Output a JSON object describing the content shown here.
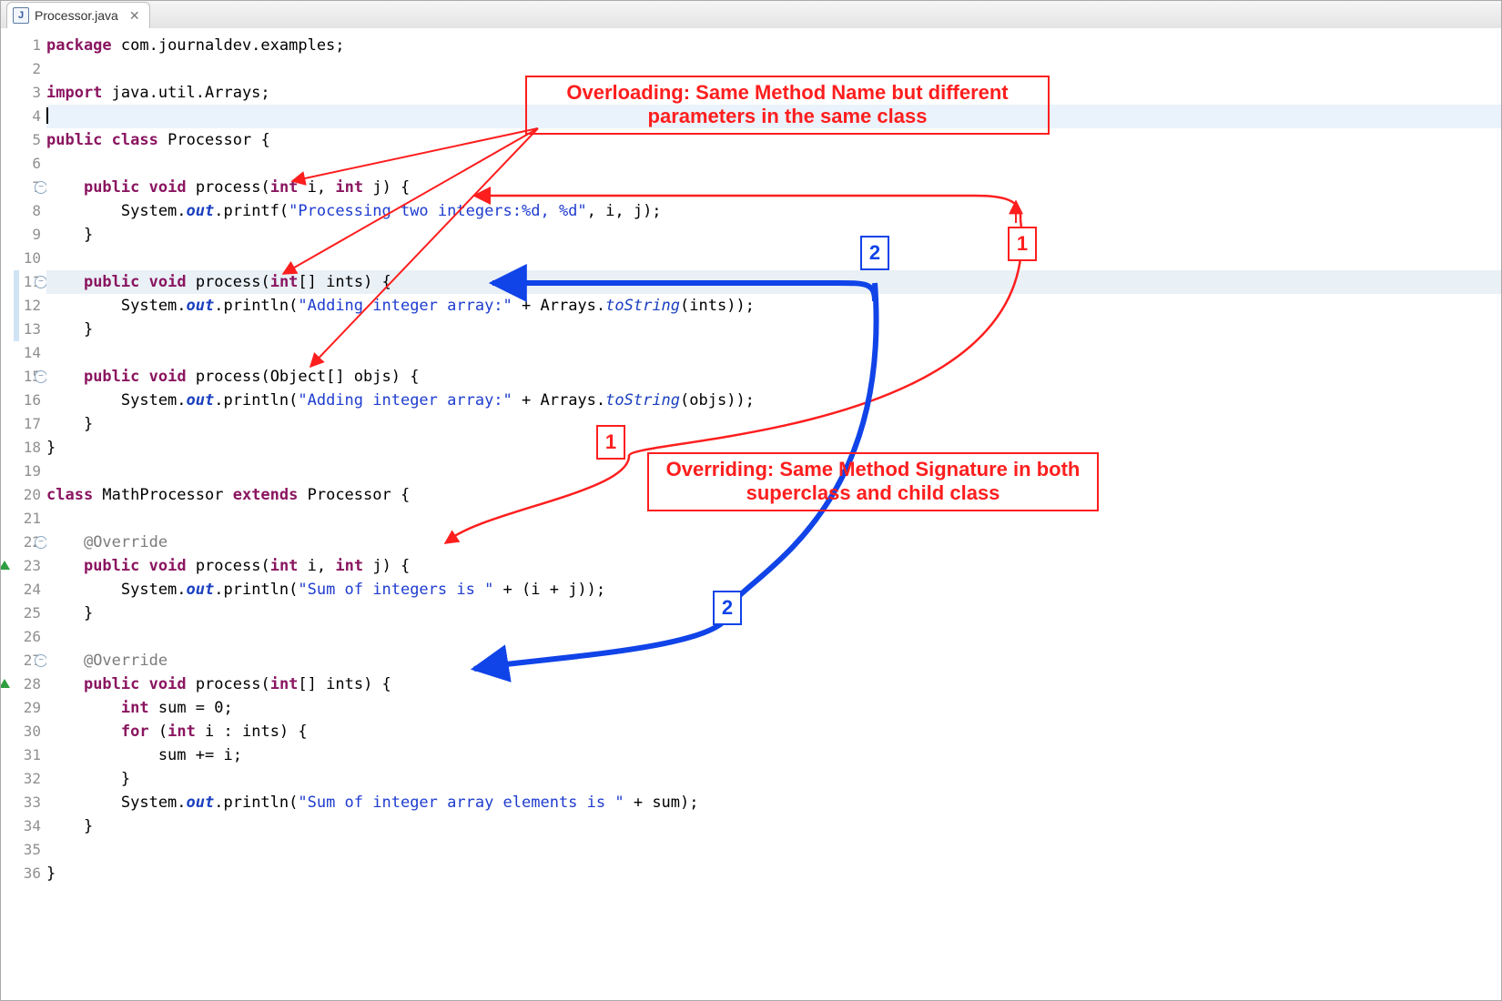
{
  "tab": {
    "filename": "Processor.java",
    "close_glyph": "✕",
    "icon_letter": "J"
  },
  "callouts": {
    "overloading": "Overloading: Same Method Name but different parameters in the same class",
    "overriding": "Overriding: Same Method Signature in both superclass and child class"
  },
  "labels": {
    "n1": "1",
    "n2": "2"
  },
  "code": {
    "lines": [
      {
        "n": 1,
        "tokens": [
          [
            "kw",
            "package"
          ],
          [
            "",
            " com.journaldev.examples;"
          ]
        ]
      },
      {
        "n": 2,
        "tokens": []
      },
      {
        "n": 3,
        "tokens": [
          [
            "kw",
            "import"
          ],
          [
            "",
            " java.util.Arrays;"
          ]
        ]
      },
      {
        "n": 4,
        "hl": "hl4",
        "cursor": true,
        "tokens": []
      },
      {
        "n": 5,
        "tokens": [
          [
            "kw",
            "public"
          ],
          [
            "",
            " "
          ],
          [
            "kw",
            "class"
          ],
          [
            "",
            " Processor {"
          ]
        ]
      },
      {
        "n": 6,
        "tokens": []
      },
      {
        "n": 7,
        "fold": true,
        "tokens": [
          [
            "",
            "    "
          ],
          [
            "kw",
            "public"
          ],
          [
            "",
            " "
          ],
          [
            "kw",
            "void"
          ],
          [
            "",
            " process("
          ],
          [
            "kw",
            "int"
          ],
          [
            "",
            " i, "
          ],
          [
            "kw",
            "int"
          ],
          [
            "",
            " j) {"
          ]
        ]
      },
      {
        "n": 8,
        "tokens": [
          [
            "",
            "        System."
          ],
          [
            "sib",
            "out"
          ],
          [
            "",
            ".printf("
          ],
          [
            "str",
            "\"Processing two integers:%d, %d\""
          ],
          [
            "",
            ", i, j);"
          ]
        ]
      },
      {
        "n": 9,
        "tokens": [
          [
            "",
            "    }"
          ]
        ]
      },
      {
        "n": 10,
        "tokens": []
      },
      {
        "n": 11,
        "fold": true,
        "hl": "hl11",
        "diff": true,
        "tokens": [
          [
            "",
            "    "
          ],
          [
            "kw",
            "public"
          ],
          [
            "",
            " "
          ],
          [
            "kw",
            "void"
          ],
          [
            "",
            " process("
          ],
          [
            "kw",
            "int"
          ],
          [
            "",
            "[] ints) {"
          ]
        ]
      },
      {
        "n": 12,
        "diff": true,
        "tokens": [
          [
            "",
            "        System."
          ],
          [
            "sib",
            "out"
          ],
          [
            "",
            ".println("
          ],
          [
            "str",
            "\"Adding integer array:\""
          ],
          [
            "",
            " + Arrays."
          ],
          [
            "si",
            "toString"
          ],
          [
            "",
            "(ints));"
          ]
        ]
      },
      {
        "n": 13,
        "diff": true,
        "tokens": [
          [
            "",
            "    }"
          ]
        ]
      },
      {
        "n": 14,
        "tokens": []
      },
      {
        "n": 15,
        "fold": true,
        "tokens": [
          [
            "",
            "    "
          ],
          [
            "kw",
            "public"
          ],
          [
            "",
            " "
          ],
          [
            "kw",
            "void"
          ],
          [
            "",
            " process(Object[] objs) {"
          ]
        ]
      },
      {
        "n": 16,
        "tokens": [
          [
            "",
            "        System."
          ],
          [
            "sib",
            "out"
          ],
          [
            "",
            ".println("
          ],
          [
            "str",
            "\"Adding integer array:\""
          ],
          [
            "",
            " + Arrays."
          ],
          [
            "si",
            "toString"
          ],
          [
            "",
            "(objs));"
          ]
        ]
      },
      {
        "n": 17,
        "tokens": [
          [
            "",
            "    }"
          ]
        ]
      },
      {
        "n": 18,
        "tokens": [
          [
            "",
            "}"
          ]
        ]
      },
      {
        "n": 19,
        "tokens": []
      },
      {
        "n": 20,
        "tokens": [
          [
            "kw",
            "class"
          ],
          [
            "",
            " MathProcessor "
          ],
          [
            "kw",
            "extends"
          ],
          [
            "",
            " Processor {"
          ]
        ]
      },
      {
        "n": 21,
        "tokens": []
      },
      {
        "n": 22,
        "fold": true,
        "tokens": [
          [
            "",
            "    "
          ],
          [
            "ann",
            "@Override"
          ]
        ]
      },
      {
        "n": 23,
        "ovr": true,
        "tokens": [
          [
            "",
            "    "
          ],
          [
            "kw",
            "public"
          ],
          [
            "",
            " "
          ],
          [
            "kw",
            "void"
          ],
          [
            "",
            " process("
          ],
          [
            "kw",
            "int"
          ],
          [
            "",
            " i, "
          ],
          [
            "kw",
            "int"
          ],
          [
            "",
            " j) {"
          ]
        ]
      },
      {
        "n": 24,
        "tokens": [
          [
            "",
            "        System."
          ],
          [
            "sib",
            "out"
          ],
          [
            "",
            ".println("
          ],
          [
            "str",
            "\"Sum of integers is \""
          ],
          [
            "",
            " + (i + j));"
          ]
        ]
      },
      {
        "n": 25,
        "tokens": [
          [
            "",
            "    }"
          ]
        ]
      },
      {
        "n": 26,
        "tokens": []
      },
      {
        "n": 27,
        "fold": true,
        "tokens": [
          [
            "",
            "    "
          ],
          [
            "ann",
            "@Override"
          ]
        ]
      },
      {
        "n": 28,
        "ovr": true,
        "tokens": [
          [
            "",
            "    "
          ],
          [
            "kw",
            "public"
          ],
          [
            "",
            " "
          ],
          [
            "kw",
            "void"
          ],
          [
            "",
            " process("
          ],
          [
            "kw",
            "int"
          ],
          [
            "",
            "[] ints) {"
          ]
        ]
      },
      {
        "n": 29,
        "tokens": [
          [
            "",
            "        "
          ],
          [
            "kw",
            "int"
          ],
          [
            "",
            " sum = 0;"
          ]
        ]
      },
      {
        "n": 30,
        "tokens": [
          [
            "",
            "        "
          ],
          [
            "kw",
            "for"
          ],
          [
            "",
            " ("
          ],
          [
            "kw",
            "int"
          ],
          [
            "",
            " i : ints) {"
          ]
        ]
      },
      {
        "n": 31,
        "tokens": [
          [
            "",
            "            sum += i;"
          ]
        ]
      },
      {
        "n": 32,
        "tokens": [
          [
            "",
            "        }"
          ]
        ]
      },
      {
        "n": 33,
        "tokens": [
          [
            "",
            "        System."
          ],
          [
            "sib",
            "out"
          ],
          [
            "",
            ".println("
          ],
          [
            "str",
            "\"Sum of integer array elements is \""
          ],
          [
            "",
            " + sum);"
          ]
        ]
      },
      {
        "n": 34,
        "tokens": [
          [
            "",
            "    }"
          ]
        ]
      },
      {
        "n": 35,
        "tokens": []
      },
      {
        "n": 36,
        "tokens": [
          [
            "",
            "}"
          ]
        ]
      }
    ]
  }
}
